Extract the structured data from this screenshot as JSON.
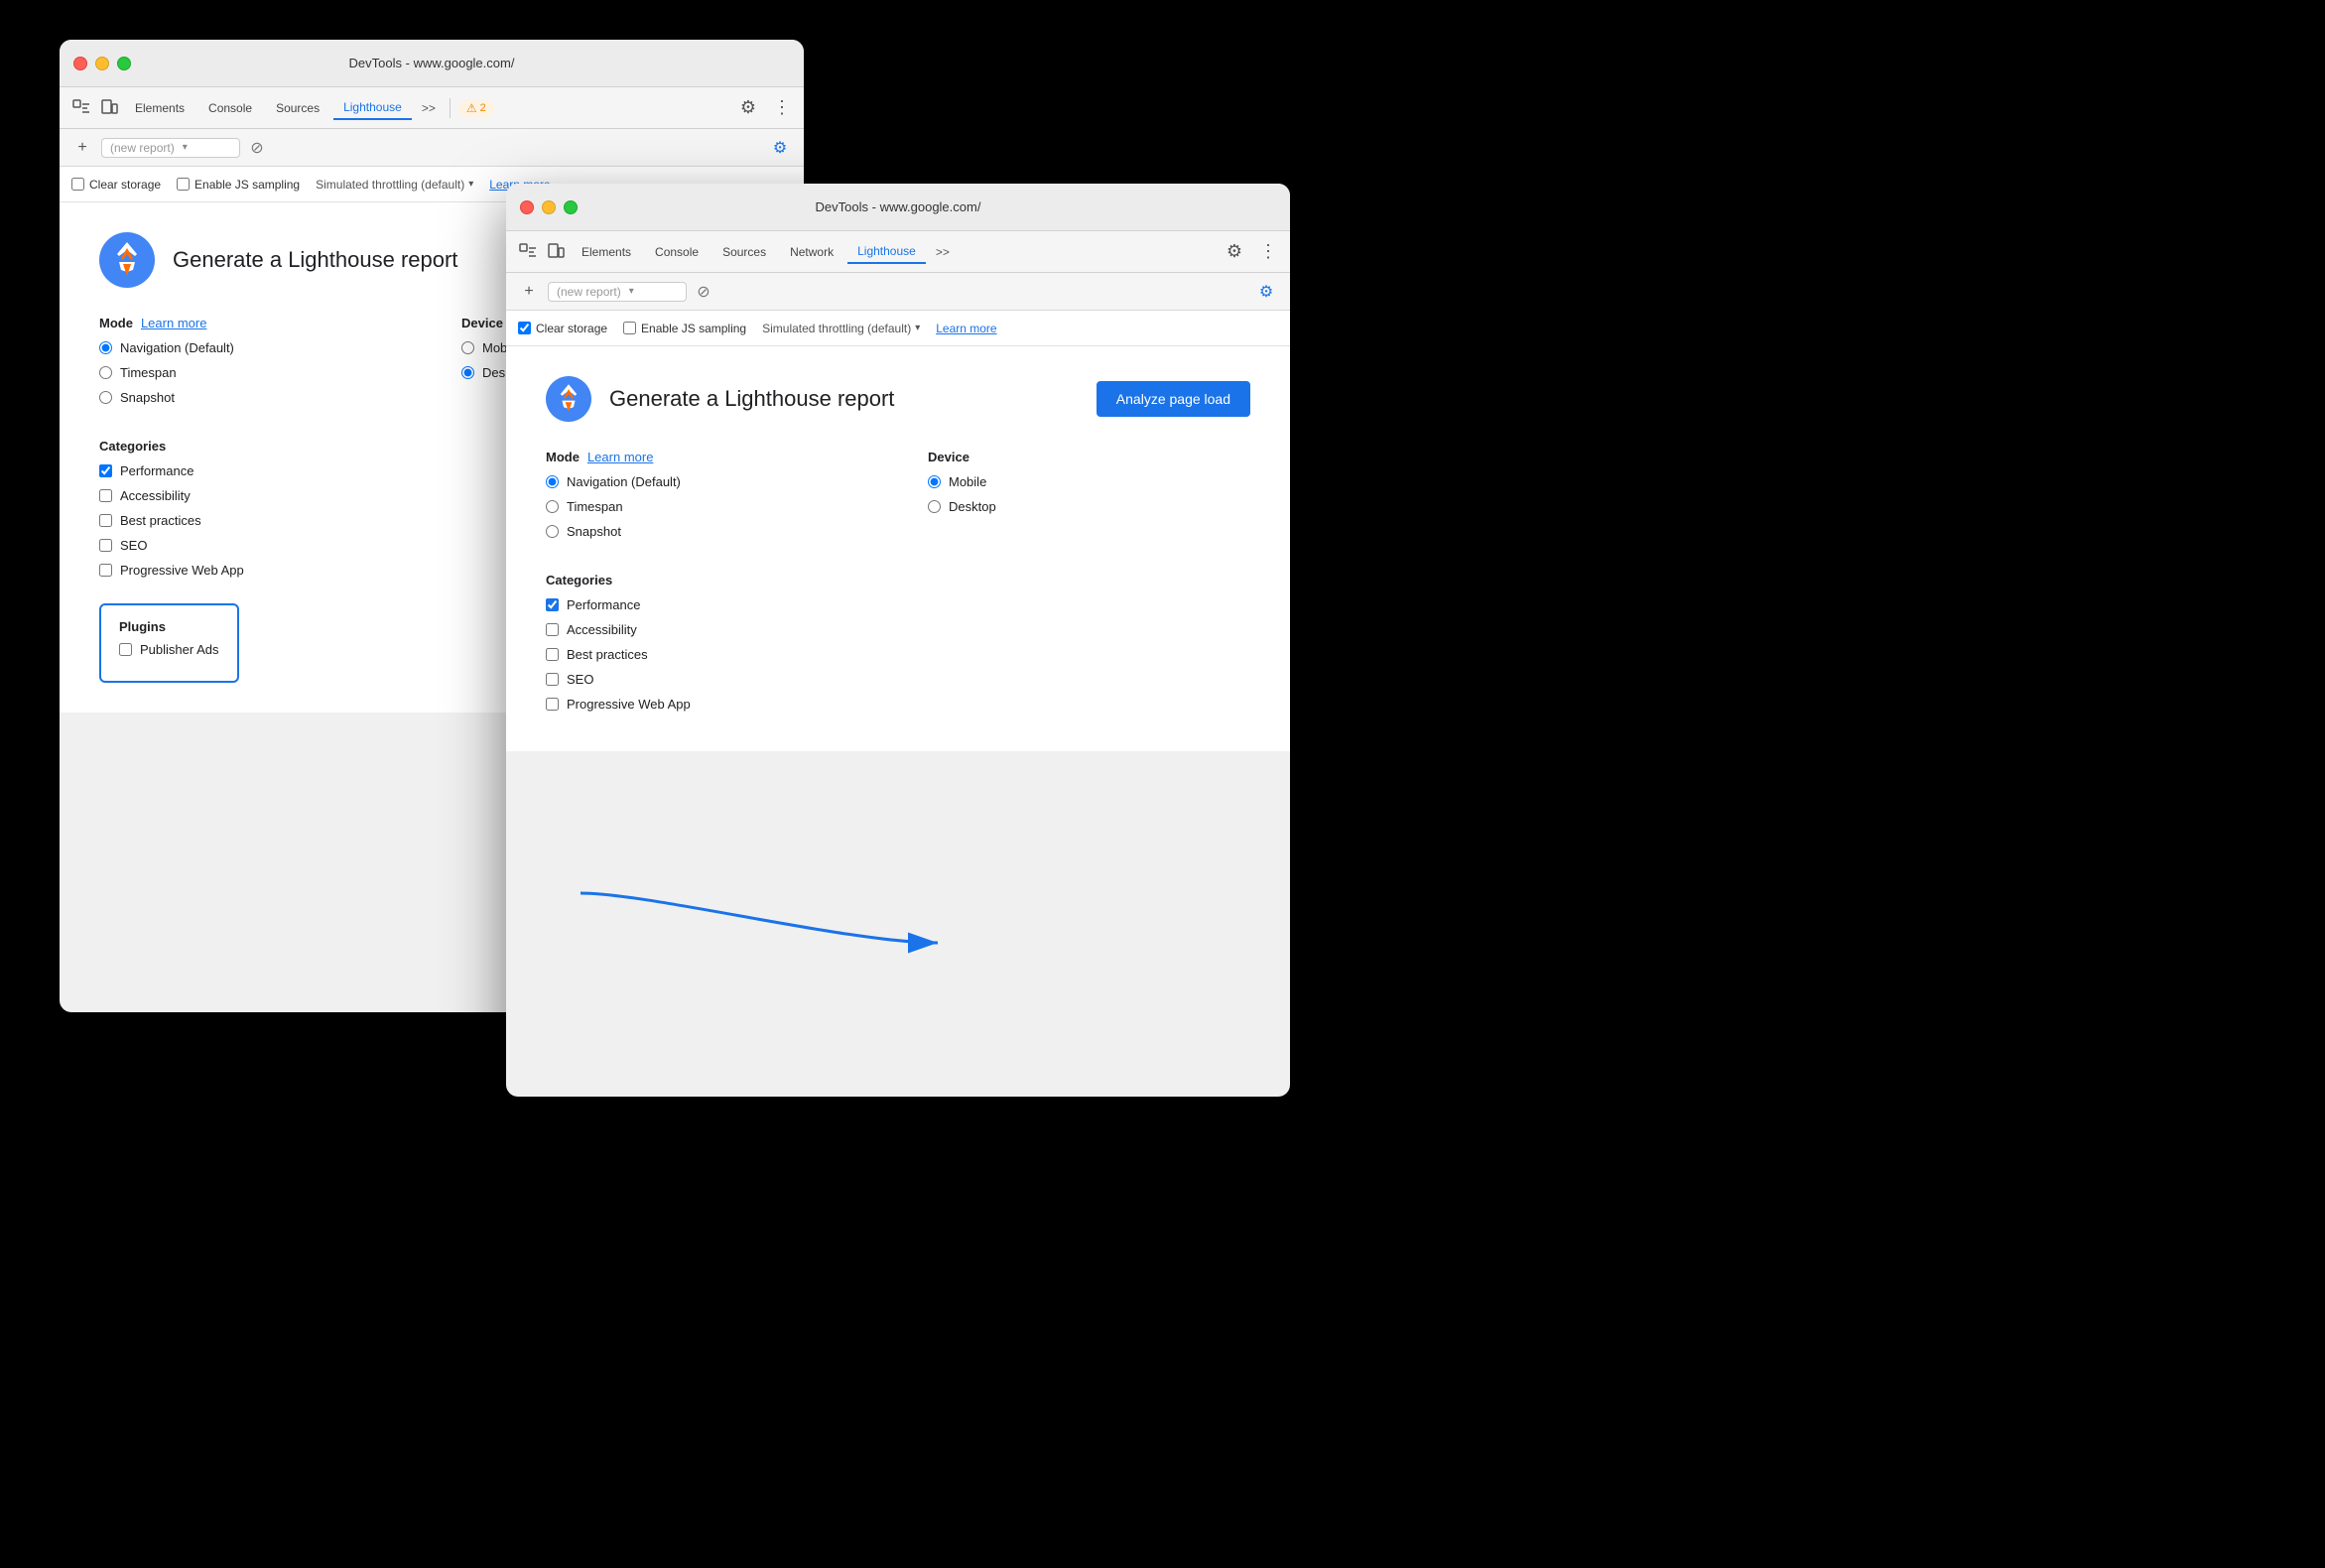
{
  "window_back": {
    "title": "DevTools - www.google.com/",
    "tabs": [
      "Elements",
      "Console",
      "Sources",
      "Lighthouse",
      ">>"
    ],
    "active_tab": "Lighthouse",
    "new_report_placeholder": "(new report)",
    "clear_storage_label": "Clear storage",
    "enable_js_label": "Enable JS sampling",
    "throttling_label": "Simulated throttling (default)",
    "learn_more": "Learn more",
    "header_title": "Generate a Lighthouse report",
    "mode_label": "Mode",
    "mode_learn_more": "Learn more",
    "device_label": "Device",
    "modes": [
      "Navigation (Default)",
      "Timespan",
      "Snapshot"
    ],
    "devices": [
      "Mobile",
      "Desktop"
    ],
    "selected_mode": "Navigation (Default)",
    "selected_device": "Desktop",
    "categories_label": "Categories",
    "categories": [
      "Performance",
      "Accessibility",
      "Best practices",
      "SEO",
      "Progressive Web App"
    ],
    "checked_categories": [
      "Performance"
    ],
    "plugins_label": "Plugins",
    "plugins": [
      "Publisher Ads"
    ],
    "warning_count": "2"
  },
  "window_front": {
    "title": "DevTools - www.google.com/",
    "tabs": [
      "Elements",
      "Console",
      "Sources",
      "Network",
      "Lighthouse",
      ">>"
    ],
    "active_tab": "Lighthouse",
    "new_report_placeholder": "(new report)",
    "clear_storage_label": "Clear storage",
    "clear_storage_checked": true,
    "enable_js_label": "Enable JS sampling",
    "throttling_label": "Simulated throttling (default)",
    "learn_more": "Learn more",
    "header_title": "Generate a Lighthouse report",
    "analyze_btn": "Analyze page load",
    "mode_label": "Mode",
    "mode_learn_more": "Learn more",
    "device_label": "Device",
    "modes": [
      "Navigation (Default)",
      "Timespan",
      "Snapshot"
    ],
    "devices": [
      "Mobile",
      "Desktop"
    ],
    "selected_mode": "Navigation (Default)",
    "selected_device": "Mobile",
    "categories_label": "Categories",
    "categories": [
      "Performance",
      "Accessibility",
      "Best practices",
      "SEO",
      "Progressive Web App"
    ],
    "checked_categories": [
      "Performance"
    ]
  },
  "colors": {
    "blue": "#1a73e8",
    "red": "#fe5f57",
    "yellow": "#febc2e",
    "green": "#28c840"
  }
}
